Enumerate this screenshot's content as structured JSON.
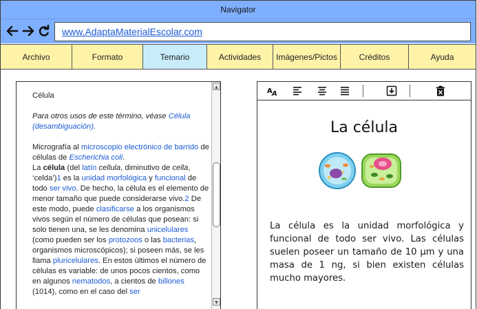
{
  "window": {
    "title": "Navigator"
  },
  "nav": {
    "url": "www.AdaptaMaterialEscolar.com",
    "icons": [
      "back-arrow-icon",
      "forward-arrow-icon",
      "reload-icon"
    ]
  },
  "menu": {
    "items": [
      {
        "label": "Archivo"
      },
      {
        "label": "Formato"
      },
      {
        "label": "Temario"
      },
      {
        "label": "Actividades"
      },
      {
        "label": "Imágenes/Pictos"
      },
      {
        "label": "Créditos"
      },
      {
        "label": "Ayuda"
      }
    ],
    "active_index": 2,
    "colors": {
      "bar": "#fff3a8",
      "active": "#c9ecfb"
    }
  },
  "article": {
    "title": "Célula",
    "disambig_prefix": "Para otros usos de este término, véase ",
    "disambig_link": "Célula (desambiguación)",
    "disambig_suffix": ".",
    "caption_prefix": "Micrografía al ",
    "caption_link1": "microscopio electrónico de barrido",
    "caption_mid": " de células de ",
    "caption_link2": "Escherichia coli",
    "caption_suffix": ".",
    "p1_a": "La ",
    "p1_bold": "célula",
    "p1_b": " (del ",
    "p1_link_latin": "latín",
    "p1_c": " ",
    "p1_cellula": "cellula",
    "p1_d": ", diminutivo de ",
    "p1_cella": "cella",
    "p1_e": ", ‘celda’)",
    "p1_ref1": "1",
    "p1_f": " es la ",
    "p1_link_morf": "unidad morfológica",
    "p1_g": " y ",
    "p1_link_func": "funcional",
    "p1_h": " de todo ",
    "p1_link_ser": "ser vivo",
    "p1_i": ". De hecho, la célula es el elemento de menor tamaño que puede considerarse vivo.",
    "p1_ref2": "2",
    "p1_j": " De este modo, puede ",
    "p1_link_clas": "clasificarse",
    "p1_k": " a los organismos vivos según el número de células que posean: si solo tienen una, se les denomina ",
    "p1_link_uni": "unicelulares",
    "p1_l": " (como pueden ser los ",
    "p1_link_proto": "protozoos",
    "p1_m": " o las ",
    "p1_link_bact": "bacterias",
    "p1_n": ", organismos microscópicos); si poseen más, se les llama ",
    "p1_link_pluri": "pluricelulares",
    "p1_o": ". En estos últimos el número de células es variable: de unos pocos cientos, como en algunos ",
    "p1_link_nema": "nematodos",
    "p1_p": ", a cientos de ",
    "p1_link_bill": "billones",
    "p1_q": " (1014), como en el caso del ",
    "p1_link_ser2": "ser"
  },
  "card": {
    "toolbar_icons": [
      "font-size-icon",
      "align-left-icon",
      "align-center-icon",
      "align-justify-icon",
      "download-icon",
      "delete-icon"
    ],
    "title": "La célula",
    "body": "La célula es la unidad morfológica y funcional de todo ser vivo. Las células suelen poseer un tamaño de 10 µm y una masa de 1 ng, si bien existen células mucho mayores."
  },
  "colors": {
    "titlebar": "#7fb0ff",
    "link": "#1a5ad6"
  }
}
